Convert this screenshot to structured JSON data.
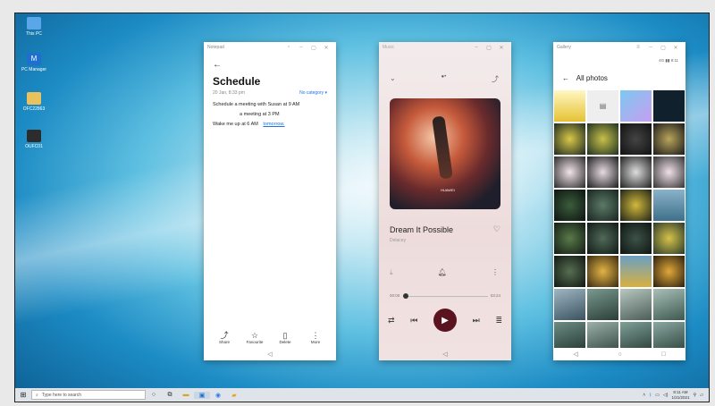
{
  "desktop": {
    "icons": [
      {
        "label": "This PC",
        "icon": "computer-icon"
      },
      {
        "label": "PC Manager",
        "icon": "pc-manager-icon"
      },
      {
        "label": "OFC22863",
        "icon": "folder-icon"
      },
      {
        "label": "OUFC01",
        "icon": "folder-icon"
      }
    ]
  },
  "notepad": {
    "window_title": "Notepad",
    "title": "Schedule",
    "date": "20 Jan, 8:33 pm",
    "category": "No category ▾",
    "lines": [
      "Schedule a meeting with Susan at 9 AM",
      "a meeting at 3 PM",
      "Wake me up at 6 AM"
    ],
    "link_text": "tomorrow.",
    "tools": [
      {
        "label": "Share",
        "icon": "share-icon",
        "glyph": "⤴"
      },
      {
        "label": "Favourite",
        "icon": "star-icon",
        "glyph": "☆"
      },
      {
        "label": "Delete",
        "icon": "trash-icon",
        "glyph": "🗑"
      },
      {
        "label": "More",
        "icon": "more-icon",
        "glyph": "⋮"
      }
    ]
  },
  "music": {
    "window_title": "Music",
    "song_title": "Dream It Possible",
    "artist": "Delacey",
    "time_elapsed": "00:00",
    "time_total": "03:24",
    "art_label": "HUAWEI",
    "progress": 0.0
  },
  "gallery": {
    "window_title": "Gallery",
    "header": "All photos",
    "status": "4G ▮▮ 8:11"
  },
  "taskbar": {
    "search_placeholder": "Type here to search",
    "time": "8:11 AM",
    "date": "1/21/2021"
  },
  "colors": {
    "accent": "#1a73e8",
    "play_button": "#5a1420"
  }
}
